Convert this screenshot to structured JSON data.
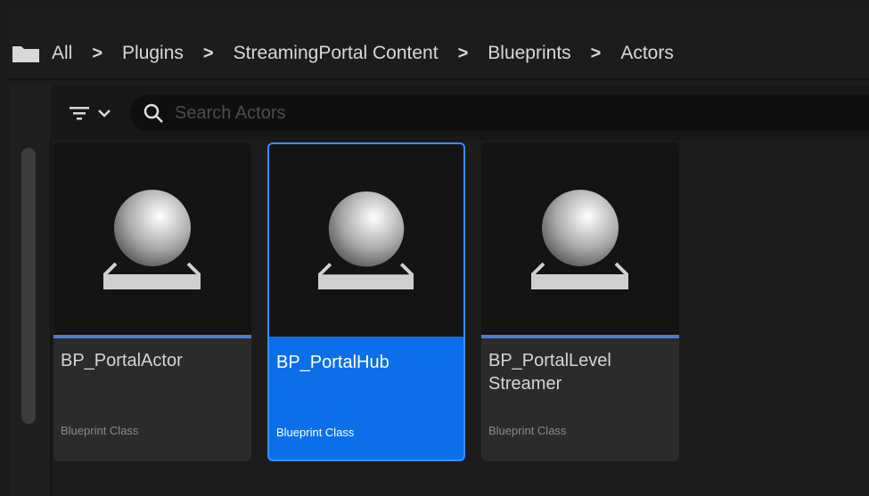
{
  "breadcrumb": {
    "icon": "folder-icon",
    "items": [
      "All",
      "Plugins",
      "StreamingPortal Content",
      "Blueprints",
      "Actors"
    ],
    "separator": ">"
  },
  "toolbar": {
    "filter_icon": "filter-icon",
    "search_placeholder": "Search Actors"
  },
  "assets": [
    {
      "name": "BP_PortalActor",
      "type": "Blueprint Class",
      "selected": false
    },
    {
      "name": "BP_PortalHub",
      "type": "Blueprint Class",
      "selected": true
    },
    {
      "name": "BP_PortalLevel Streamer",
      "type": "Blueprint Class",
      "selected": false
    }
  ],
  "colors": {
    "selection": "#0a6fe8",
    "accent_bar": "#4a7bd6",
    "background": "#1c1c1c"
  }
}
